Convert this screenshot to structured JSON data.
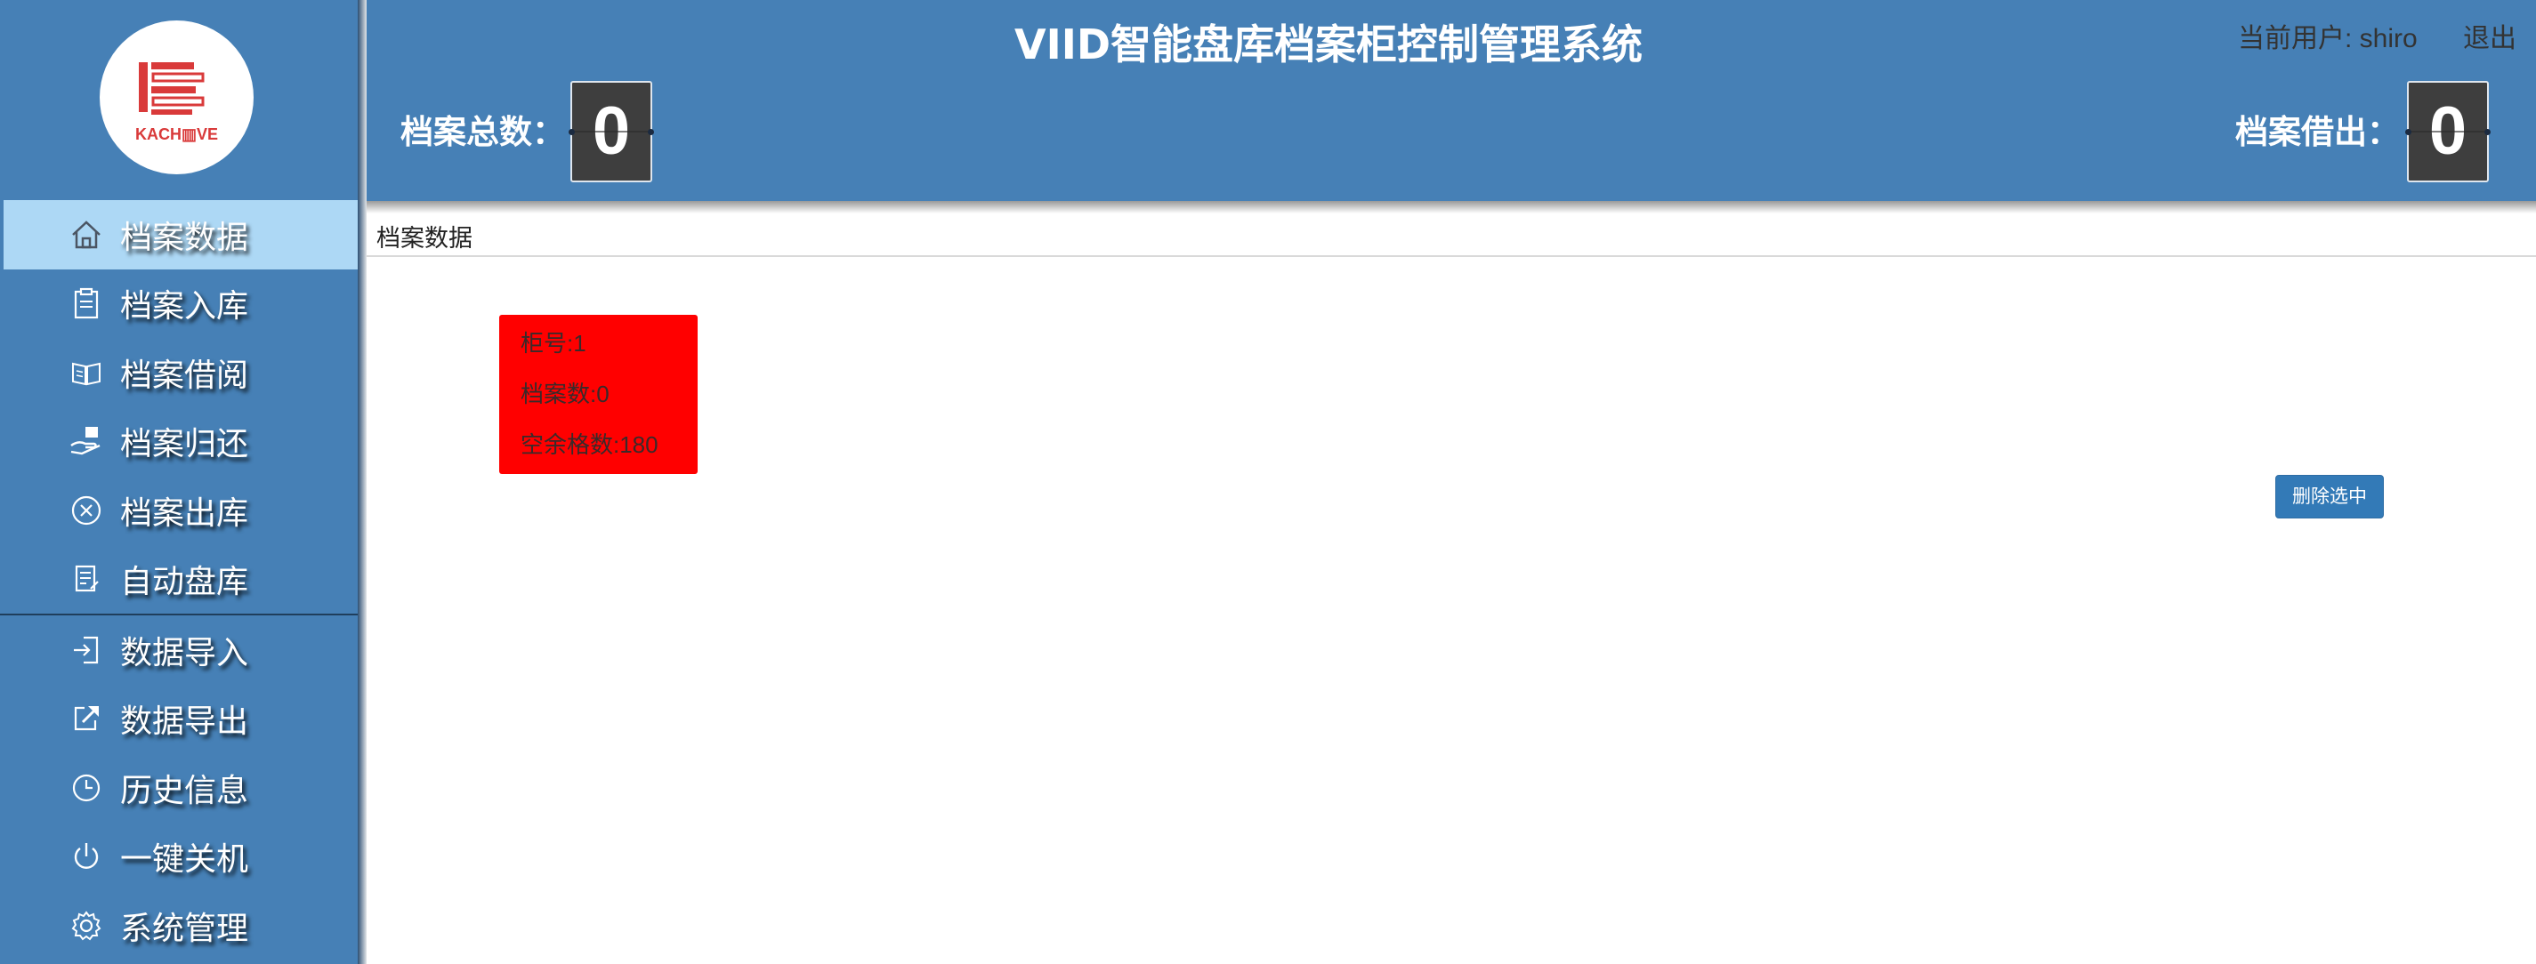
{
  "logo": {
    "text": "KACH▥VE"
  },
  "header": {
    "title": "VIID智能盘库档案柜控制管理系统",
    "user_label": "当前用户: shiro",
    "logout_label": "退出",
    "total_label": "档案总数：",
    "total_value": "0",
    "borrowed_label": "档案借出：",
    "borrowed_value": "0"
  },
  "sidebar": {
    "items": [
      {
        "label": "档案数据",
        "icon": "home-icon",
        "active": true
      },
      {
        "label": "档案入库",
        "icon": "clipboard-icon"
      },
      {
        "label": "档案借阅",
        "icon": "open-book-icon"
      },
      {
        "label": "档案归还",
        "icon": "hand-return-icon"
      },
      {
        "label": "档案出库",
        "icon": "circle-x-icon"
      },
      {
        "label": "自动盘库",
        "icon": "edit-doc-icon"
      },
      {
        "label": "数据导入",
        "icon": "import-icon"
      },
      {
        "label": "数据导出",
        "icon": "export-icon"
      },
      {
        "label": "历史信息",
        "icon": "clock-icon"
      },
      {
        "label": "一键关机",
        "icon": "power-icon"
      },
      {
        "label": "系统管理",
        "icon": "gear-icon"
      }
    ]
  },
  "content": {
    "breadcrumb": "档案数据",
    "cabinet": {
      "number_text": "柜号:1",
      "files_text": "档案数:0",
      "empty_text": "空余格数:180",
      "color": "#ff0000"
    },
    "delete_button": "删除选中"
  },
  "colors": {
    "primary": "#4680b6",
    "active_item": "#add8f5",
    "button": "#337ab7"
  }
}
